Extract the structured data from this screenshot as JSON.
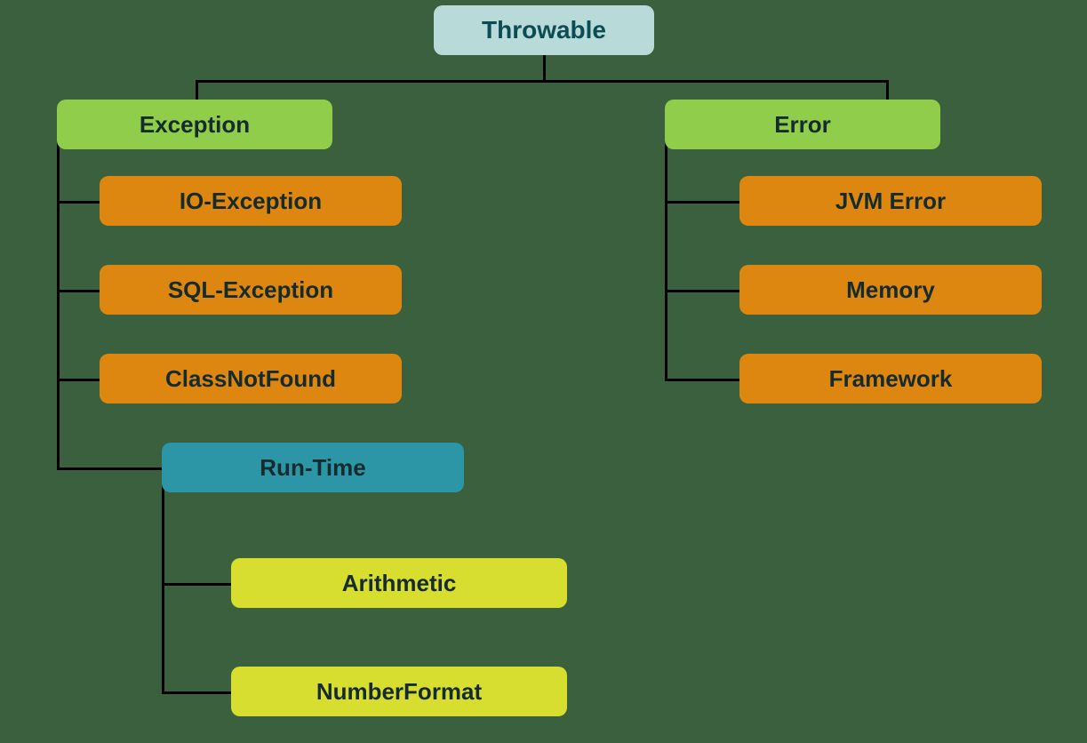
{
  "nodes": {
    "throwable": "Throwable",
    "exception": "Exception",
    "error": "Error",
    "io_exception": "IO-Exception",
    "sql_exception": "SQL-Exception",
    "class_not_found": "ClassNotFound",
    "run_time": "Run-Time",
    "arithmetic": "Arithmetic",
    "number_format": "NumberFormat",
    "jvm_error": "JVM Error",
    "memory": "Memory",
    "framework": "Framework"
  }
}
